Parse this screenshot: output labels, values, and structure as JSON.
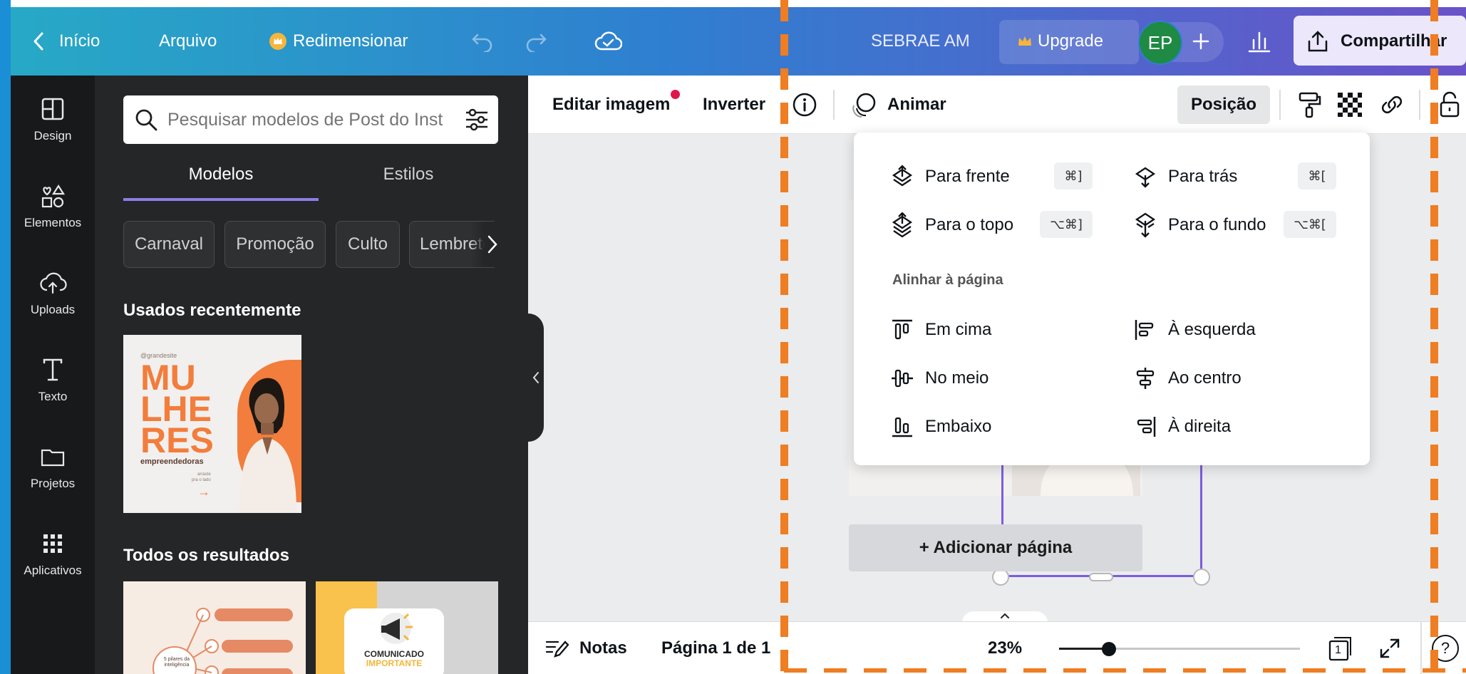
{
  "header": {
    "back_label": "Início",
    "file_label": "Arquivo",
    "resize_label": "Redimensionar",
    "team_name": "SEBRAE AM",
    "upgrade_label": "Upgrade",
    "avatar_initials": "EP",
    "share_label": "Compartilhar"
  },
  "rail": {
    "items": [
      {
        "label": "Design"
      },
      {
        "label": "Elementos"
      },
      {
        "label": "Uploads"
      },
      {
        "label": "Texto"
      },
      {
        "label": "Projetos"
      },
      {
        "label": "Aplicativos"
      }
    ]
  },
  "panel": {
    "search_placeholder": "Pesquisar modelos de Post do Inst",
    "tabs": [
      {
        "label": "Modelos"
      },
      {
        "label": "Estilos"
      }
    ],
    "chips": [
      "Carnaval",
      "Promoção",
      "Culto",
      "Lembrete"
    ],
    "recent_title": "Usados recentemente",
    "all_title": "Todos os resultados",
    "template1": {
      "handle": "@grandesite",
      "title_l1": "MU",
      "title_l2": "LHE",
      "title_l3": "RES",
      "subtitle": "empreendedoras",
      "small1": "arraste",
      "small2": "pra o lado"
    },
    "template2": {
      "line1": "5 pilares da",
      "line2": "inteligência"
    },
    "template3": {
      "line1": "COMUNICADO",
      "line2": "IMPORTANTE"
    }
  },
  "toolbar": {
    "edit_image_label": "Editar imagem",
    "flip_label": "Inverter",
    "animate_label": "Animar",
    "position_label": "Posição"
  },
  "position_menu": {
    "layer_items": [
      {
        "label": "Para frente",
        "shortcut": "⌘]"
      },
      {
        "label": "Para trás",
        "shortcut": "⌘["
      },
      {
        "label": "Para o topo",
        "shortcut": "⌥⌘]"
      },
      {
        "label": "Para o fundo",
        "shortcut": "⌥⌘["
      }
    ],
    "align_title": "Alinhar à página",
    "align_items": [
      {
        "label": "Em cima"
      },
      {
        "label": "À esquerda"
      },
      {
        "label": "No meio"
      },
      {
        "label": "Ao centro"
      },
      {
        "label": "Embaixo"
      },
      {
        "label": "À direita"
      }
    ]
  },
  "canvas": {
    "add_page_label": "+ Adicionar página"
  },
  "footer": {
    "notes_label": "Notas",
    "page_indicator": "Página 1 de 1",
    "zoom": "23%",
    "zoom_fraction": 0.23,
    "pages_count": "1",
    "help_label": "?"
  },
  "colors": {
    "brand_purple": "#7d5ce0",
    "crown_gold": "#f4b63b",
    "avatar_green": "#1e8a43",
    "notification_dot": "#e0164b",
    "guide_orange": "#ef7d22"
  }
}
